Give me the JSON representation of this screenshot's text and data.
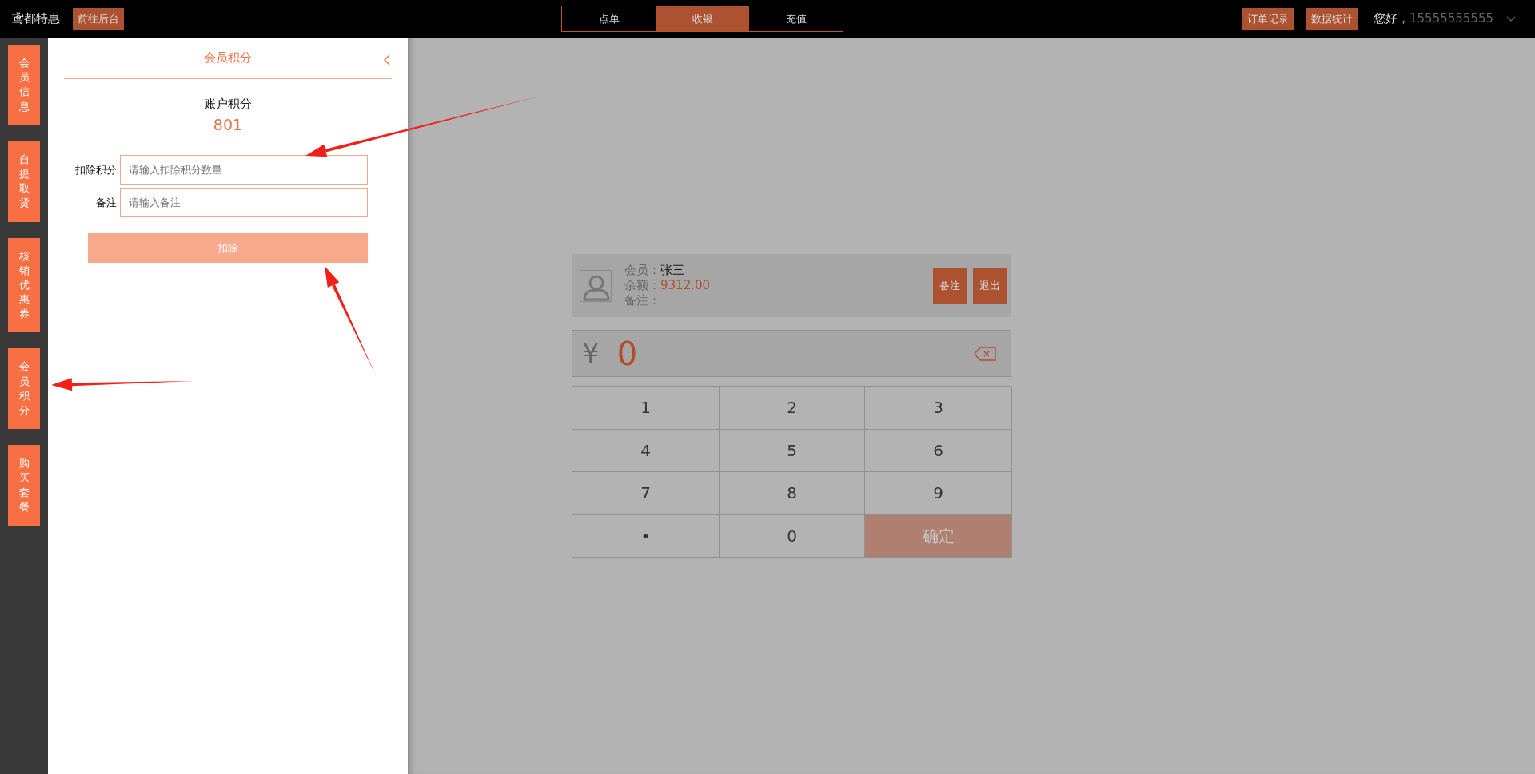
{
  "header": {
    "brand": "鸢都特惠",
    "backend_button": "前往后台",
    "tabs": [
      {
        "label": "点单",
        "selected": false
      },
      {
        "label": "收银",
        "selected": true
      },
      {
        "label": "充值",
        "selected": false
      }
    ],
    "actions": [
      "订单记录",
      "数据统计"
    ],
    "greeting": "您好，",
    "user": "15555555555"
  },
  "sidebar": {
    "items": [
      {
        "label": "会员信息"
      },
      {
        "label": "自提取货"
      },
      {
        "label": "核销优惠券"
      },
      {
        "label": "会员积分"
      },
      {
        "label": "购买套餐"
      }
    ]
  },
  "panel": {
    "title": "会员积分",
    "balance_label": "账户积分",
    "balance": "801",
    "fields": [
      {
        "label": "扣除积分",
        "placeholder": "请输入扣除积分数量"
      },
      {
        "label": "备注",
        "placeholder": "请输入备注"
      }
    ],
    "submit": "扣除"
  },
  "member": {
    "rows": [
      {
        "label": "会员：",
        "value": "张三",
        "kind": "name"
      },
      {
        "label": "余额：",
        "value": "9312.00",
        "kind": "money"
      },
      {
        "label": "备注："
      }
    ],
    "buttons": [
      "备注",
      "退出"
    ]
  },
  "amount": {
    "currency": "¥",
    "value": "0"
  },
  "keypad": [
    {
      "label": "1",
      "kind": "digit"
    },
    {
      "label": "2",
      "kind": "digit"
    },
    {
      "label": "3",
      "kind": "digit"
    },
    {
      "label": "4",
      "kind": "digit"
    },
    {
      "label": "5",
      "kind": "digit"
    },
    {
      "label": "6",
      "kind": "digit"
    },
    {
      "label": "7",
      "kind": "digit"
    },
    {
      "label": "8",
      "kind": "digit"
    },
    {
      "label": "9",
      "kind": "digit"
    },
    {
      "label": "•",
      "kind": "digit"
    },
    {
      "label": "0",
      "kind": "digit"
    },
    {
      "label": "确定",
      "kind": "confirm"
    }
  ]
}
